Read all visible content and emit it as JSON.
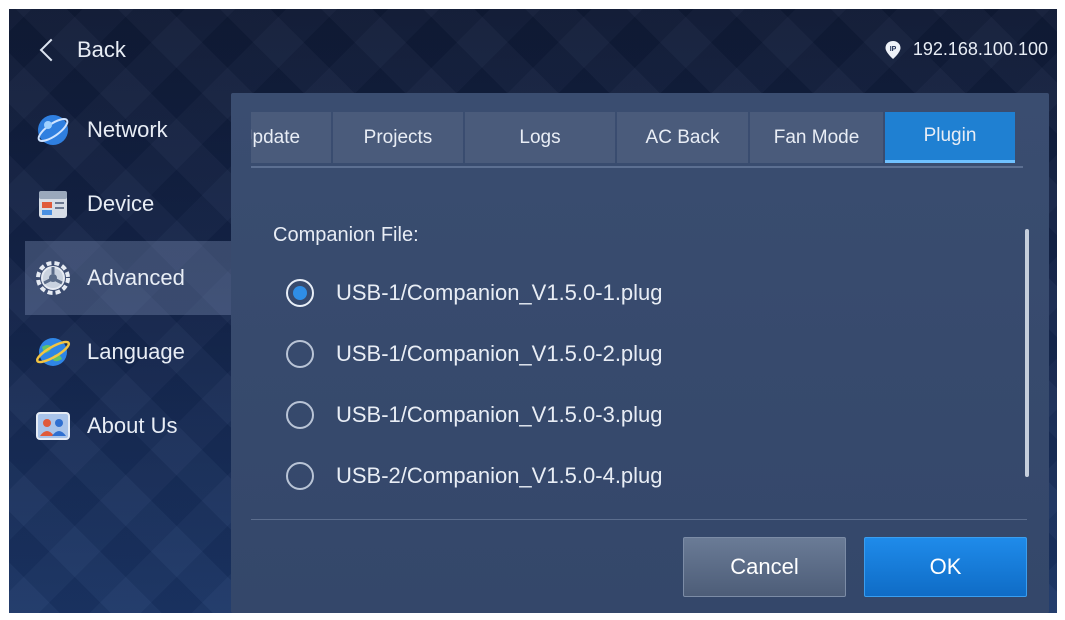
{
  "header": {
    "back_label": "Back",
    "ip_address": "192.168.100.100",
    "ip_icon": "ip-pin-icon"
  },
  "sidebar": {
    "items": [
      {
        "label": "Network",
        "icon": "network-globe-icon",
        "active": false
      },
      {
        "label": "Device",
        "icon": "device-server-icon",
        "active": false
      },
      {
        "label": "Advanced",
        "icon": "gear-icon",
        "active": true
      },
      {
        "label": "Language",
        "icon": "language-globe-icon",
        "active": false
      },
      {
        "label": "About Us",
        "icon": "people-icon",
        "active": false
      }
    ]
  },
  "tabs": [
    {
      "label": "Jpdate",
      "active": false
    },
    {
      "label": "Projects",
      "active": false
    },
    {
      "label": "Logs",
      "active": false
    },
    {
      "label": "AC Back",
      "active": false
    },
    {
      "label": "Fan Mode",
      "active": false
    },
    {
      "label": "Plugin",
      "active": true
    }
  ],
  "content": {
    "field_label": "Companion File:",
    "options": [
      {
        "label": "USB-1/Companion_V1.5.0-1.plug",
        "checked": true
      },
      {
        "label": "USB-1/Companion_V1.5.0-2.plug",
        "checked": false
      },
      {
        "label": "USB-1/Companion_V1.5.0-3.plug",
        "checked": false
      },
      {
        "label": "USB-2/Companion_V1.5.0-4.plug",
        "checked": false
      }
    ]
  },
  "buttons": {
    "cancel_label": "Cancel",
    "ok_label": "OK"
  },
  "colors": {
    "accent": "#1f80d2",
    "panel": "#3a4d70",
    "background": "#14244a"
  }
}
